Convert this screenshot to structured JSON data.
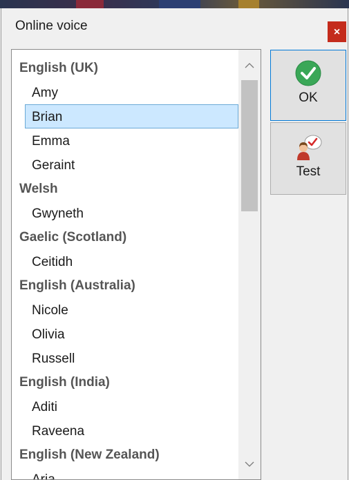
{
  "window": {
    "title": "Online voice",
    "close_glyph": "×"
  },
  "list": {
    "rows": [
      {
        "type": "group",
        "label": "English (UK)"
      },
      {
        "type": "voice",
        "label": "Amy"
      },
      {
        "type": "voice",
        "label": "Brian",
        "selected": true
      },
      {
        "type": "voice",
        "label": "Emma"
      },
      {
        "type": "voice",
        "label": "Geraint"
      },
      {
        "type": "group",
        "label": "Welsh"
      },
      {
        "type": "voice",
        "label": "Gwyneth"
      },
      {
        "type": "group",
        "label": "Gaelic (Scotland)"
      },
      {
        "type": "voice",
        "label": "Ceitidh"
      },
      {
        "type": "group",
        "label": "English (Australia)"
      },
      {
        "type": "voice",
        "label": "Nicole"
      },
      {
        "type": "voice",
        "label": "Olivia"
      },
      {
        "type": "voice",
        "label": "Russell"
      },
      {
        "type": "group",
        "label": "English (India)"
      },
      {
        "type": "voice",
        "label": "Aditi"
      },
      {
        "type": "voice",
        "label": "Raveena"
      },
      {
        "type": "group",
        "label": "English (New Zealand)"
      },
      {
        "type": "voice",
        "label": "Aria"
      }
    ]
  },
  "buttons": {
    "ok_label": "OK",
    "ok_icon": "checkmark-circle-icon",
    "test_label": "Test",
    "test_icon": "person-speech-check-icon"
  },
  "colors": {
    "close_bg": "#c42b1c",
    "selection_bg": "#cce8ff",
    "ok_icon_green": "#3aa757",
    "focus_border": "#0078d7"
  }
}
